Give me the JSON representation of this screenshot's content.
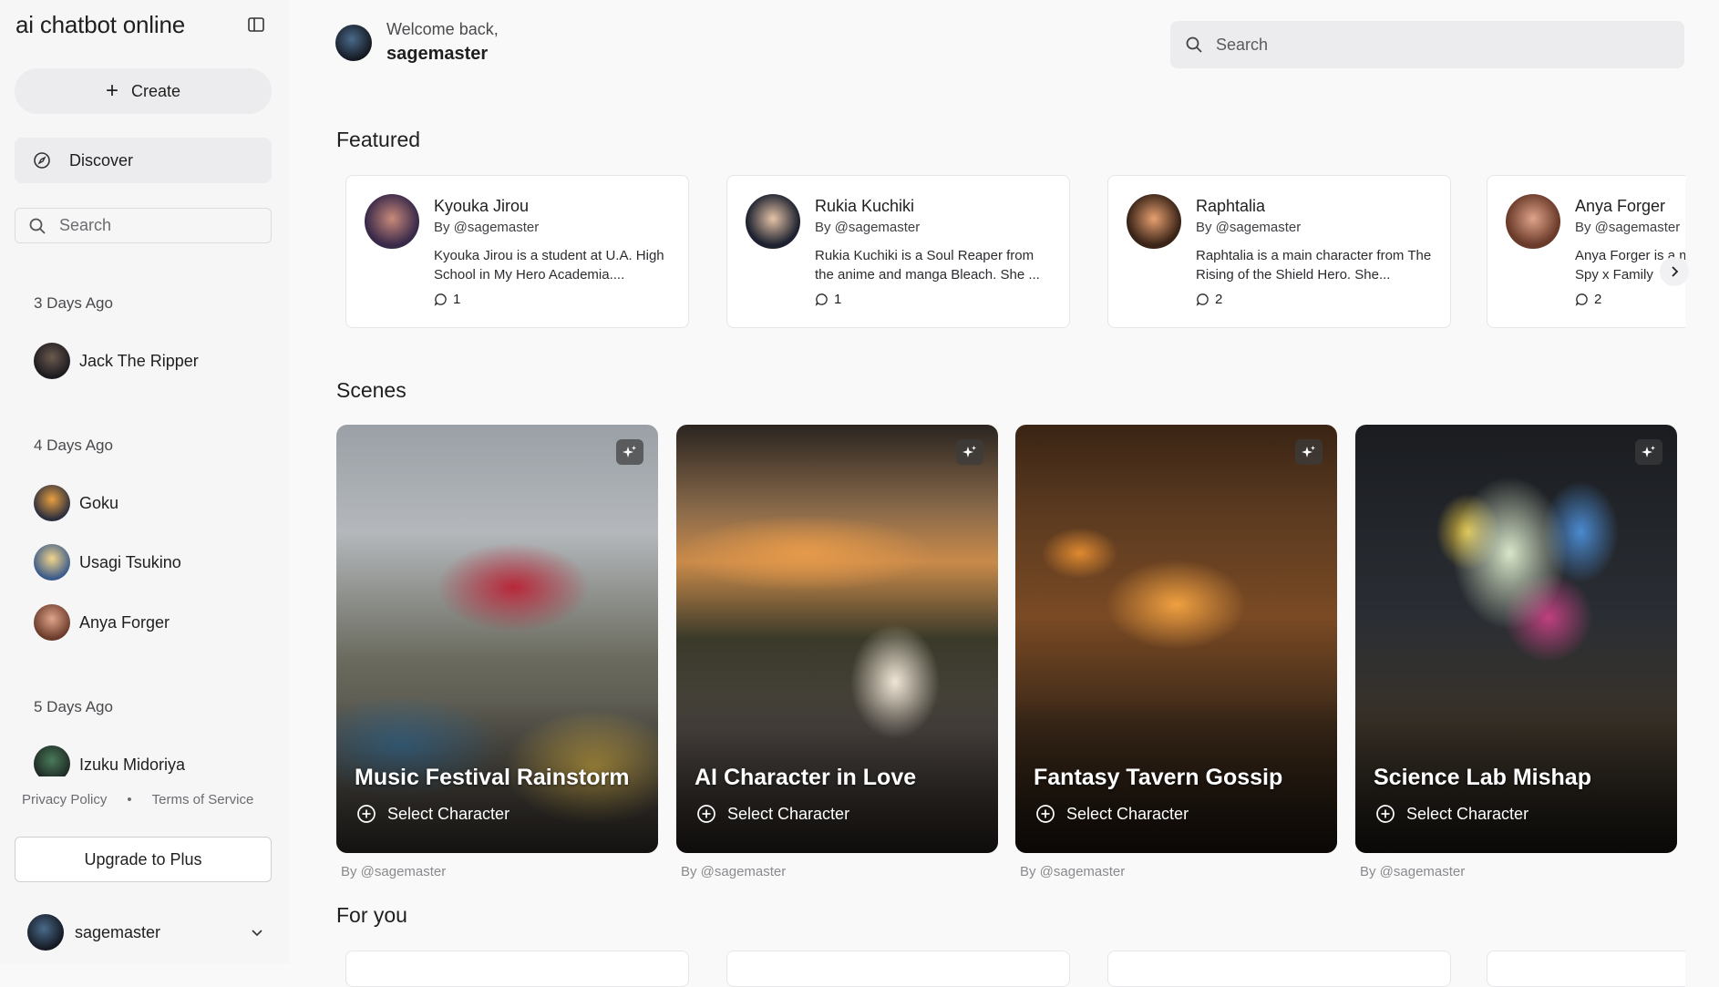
{
  "app": {
    "title": "ai chatbot online"
  },
  "sidebar": {
    "create_label": "Create",
    "discover_label": "Discover",
    "search_placeholder": "Search",
    "groups": [
      {
        "label": "3 Days Ago",
        "items": [
          {
            "name": "Jack The Ripper"
          }
        ]
      },
      {
        "label": "4 Days Ago",
        "items": [
          {
            "name": "Goku"
          },
          {
            "name": "Usagi Tsukino"
          },
          {
            "name": "Anya Forger"
          }
        ]
      },
      {
        "label": "5 Days Ago",
        "items": [
          {
            "name": "Izuku Midoriya"
          }
        ]
      }
    ],
    "privacy_label": "Privacy Policy",
    "separator": "•",
    "terms_label": "Terms of Service",
    "upgrade_label": "Upgrade to Plus",
    "user_name": "sagemaster"
  },
  "header": {
    "welcome_label": "Welcome back,",
    "username": "sagemaster",
    "search_placeholder": "Search"
  },
  "sections": {
    "featured": "Featured",
    "scenes": "Scenes",
    "for_you": "For you"
  },
  "featured": [
    {
      "name": "Kyouka Jirou",
      "by": "By @sagemaster",
      "description": "Kyouka Jirou is a student at U.A. High School in My Hero Academia....",
      "count": "1"
    },
    {
      "name": "Rukia Kuchiki",
      "by": "By @sagemaster",
      "description": "Rukia Kuchiki is a Soul Reaper from the anime and manga Bleach. She ...",
      "count": "1"
    },
    {
      "name": "Raphtalia",
      "by": "By @sagemaster",
      "description": "Raphtalia is a main character from The Rising of the Shield Hero. She...",
      "count": "2"
    },
    {
      "name": "Anya Forger",
      "by": "By @sagemaster",
      "description": "Anya Forger is a main character from Spy x Family",
      "count": "2"
    }
  ],
  "scenes": [
    {
      "title": "Music Festival Rainstorm",
      "action": "Select Character",
      "by": "By @sagemaster"
    },
    {
      "title": "AI Character in Love",
      "action": "Select Character",
      "by": "By @sagemaster"
    },
    {
      "title": "Fantasy Tavern Gossip",
      "action": "Select Character",
      "by": "By @sagemaster"
    },
    {
      "title": "Science Lab Mishap",
      "action": "Select Character",
      "by": "By @sagemaster"
    }
  ],
  "icons": {
    "collapse": "sidebar-toggle-icon",
    "create": "plus-icon",
    "discover": "compass-icon",
    "search": "search-icon",
    "comment": "comment-icon",
    "chevron_down": "chevron-down-icon",
    "chevron_right": "chevron-right-icon",
    "sparkle": "sparkle-icon",
    "select": "plus-circle-icon"
  }
}
